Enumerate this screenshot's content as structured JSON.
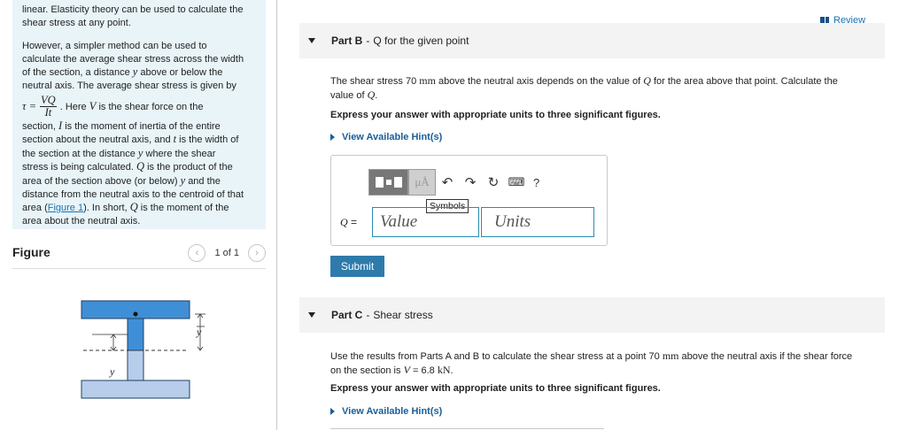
{
  "intro": {
    "line0": "linear. Elasticity theory can be used to calculate the",
    "line1": "shear stress at any point.",
    "p2_line1": "However, a simpler method can be used to",
    "p2_line2": "calculate the average shear stress across the width",
    "p2_line3_pre": "of the section, a distance",
    "p2_line3_var": "y",
    "p2_line3_post": "above or below the",
    "p2_line4": "neutral axis. The average shear stress is given by",
    "formula_lhs": "τ =",
    "formula_num": "VQ",
    "formula_den": "It",
    "formula_after_pre": ". Here",
    "formula_after_var": "V",
    "formula_after_post": "is the shear force on the",
    "l6_pre": "section,",
    "l6_var": "I",
    "l6_post": "is the moment of inertia of the entire",
    "l7_pre": "section about the neutral axis, and",
    "l7_var": "t",
    "l7_post": "is the width of",
    "l8_pre": "the section at the distance",
    "l8_var": "y",
    "l8_post": "where the shear",
    "l9_pre": "stress is being calculated.",
    "l9_var": "Q",
    "l9_post": "is the product of the",
    "l10_pre": "area of the section above (or below)",
    "l10_var": "y",
    "l10_post": "and the",
    "l11": "distance from the neutral axis to the centroid of that",
    "l12_pre": "area (",
    "l12_link": "Figure 1",
    "l12_mid": "). In short,",
    "l12_var": "Q",
    "l12_post": "is the moment of the",
    "l13": "area about the neutral axis."
  },
  "figure": {
    "title": "Figure",
    "pager_text": "1 of 1",
    "prev_icon": "chevron-left-icon",
    "next_icon": "chevron-right-icon",
    "ybar_label": "y",
    "y_label": "y"
  },
  "review": {
    "label": "Review",
    "icon": "review-icon"
  },
  "partB": {
    "part": "Part B",
    "sep": "-",
    "name": "Q for the given point",
    "q1_pre": "The shear stress 70",
    "q1_unit": "mm",
    "q1_mid": "above the neutral axis depends on the value of",
    "q1_var": "Q",
    "q1_post": "for the area above that point. Calculate the",
    "q2_pre": "value of",
    "q2_var": "Q",
    "q2_post": ".",
    "instruction": "Express your answer with appropriate units to three significant figures.",
    "hint": "View Available Hint(s)",
    "tooltip": "Symbols",
    "mu": "μÅ",
    "q_var": "Q",
    "q_eq": "=",
    "value_placeholder": "Value",
    "units_placeholder": "Units",
    "help": "?",
    "submit": "Submit"
  },
  "partC": {
    "part": "Part C",
    "sep": "-",
    "name": "Shear stress",
    "q1_pre": "Use the results from Parts A and B to calculate the shear stress at a point 70",
    "q1_unit": "mm",
    "q1_post": "above the neutral axis if the shear force",
    "q2_pre": "on the section is",
    "q2_var": "V",
    "q2_eq": "= 6.8",
    "q2_unit": "kN",
    "q2_post": ".",
    "instruction": "Express your answer with appropriate units to three significant figures.",
    "hint": "View Available Hint(s)"
  },
  "colors": {
    "accent": "#2e7bab",
    "link": "#1a73b5",
    "intro_bg": "#e8f4f8",
    "beam": "#3f8fd6",
    "beam_light": "#b7cdea"
  }
}
